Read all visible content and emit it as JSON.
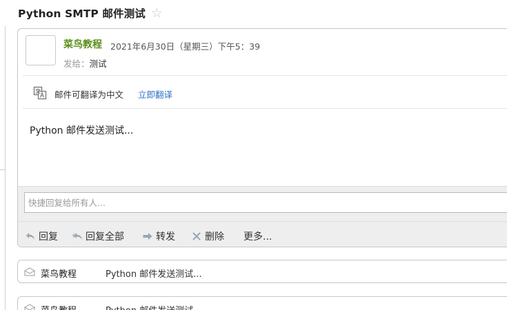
{
  "email": {
    "subject": "Python SMTP 邮件测试",
    "star_glyph": "☆",
    "sender_name": "菜鸟教程",
    "datetime": "2021年6月30日（星期三）下午5：39",
    "to_label": "发给：",
    "to_value": "测试",
    "translate_text": "邮件可翻译为中文",
    "translate_link": "立即翻译",
    "body": "Python 邮件发送测试..."
  },
  "reply": {
    "placeholder": "快捷回复给所有人..."
  },
  "actions": {
    "reply": "回复",
    "reply_all": "回复全部",
    "forward": "转发",
    "delete": "删除",
    "more": "更多..."
  },
  "thread": [
    {
      "sender": "菜鸟教程",
      "snippet": "Python 邮件发送测试..."
    },
    {
      "sender": "菜鸟教程",
      "snippet": "Python 邮件发送测试..."
    }
  ],
  "colors": {
    "sender": "#5c8f1b",
    "link": "#2b73c7",
    "toolbar_bg": "#eeeeee",
    "icon_gray": "#9aa6b2"
  },
  "icons": {
    "star": "star-icon",
    "translate": "translate-icon",
    "reply": "reply-icon",
    "reply_all": "reply-all-icon",
    "forward": "forward-icon",
    "delete": "delete-icon",
    "envelope": "envelope-icon"
  }
}
